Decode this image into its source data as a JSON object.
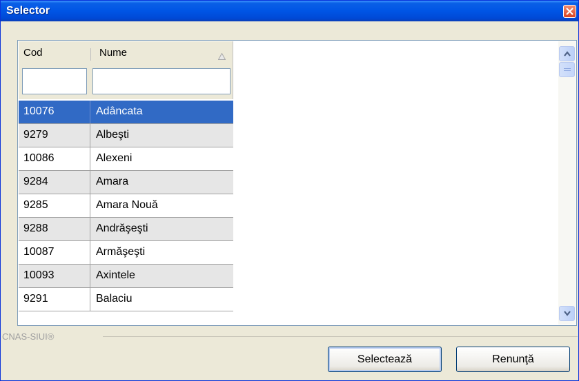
{
  "window": {
    "title": "Selector"
  },
  "grid": {
    "columns": [
      "Cod",
      "Nume"
    ],
    "filters": {
      "cod": "",
      "nume": ""
    },
    "rows": [
      {
        "cod": "10076",
        "nume": "Adâncata",
        "selected": true
      },
      {
        "cod": "9279",
        "nume": "Albeşti"
      },
      {
        "cod": "10086",
        "nume": "Alexeni"
      },
      {
        "cod": "9284",
        "nume": "Amara"
      },
      {
        "cod": "9285",
        "nume": "Amara Nouă"
      },
      {
        "cod": "9288",
        "nume": "Andrăşeşti"
      },
      {
        "cod": "10087",
        "nume": "Armăşeşti"
      },
      {
        "cod": "10093",
        "nume": "Axintele"
      },
      {
        "cod": "9291",
        "nume": "Balaciu"
      }
    ]
  },
  "footer": {
    "brand": "CNAS-SIUI®"
  },
  "buttons": {
    "select": "Selectează",
    "cancel": "Renunţă"
  },
  "colors": {
    "title_bar": "#0055E5",
    "selected_row": "#316AC5",
    "alt_row": "#E6E6E6"
  },
  "icons": {
    "close": "close-icon",
    "sort": "sort-ascending-icon",
    "scroll_up": "chevron-up-icon",
    "scroll_down": "chevron-down-icon"
  }
}
